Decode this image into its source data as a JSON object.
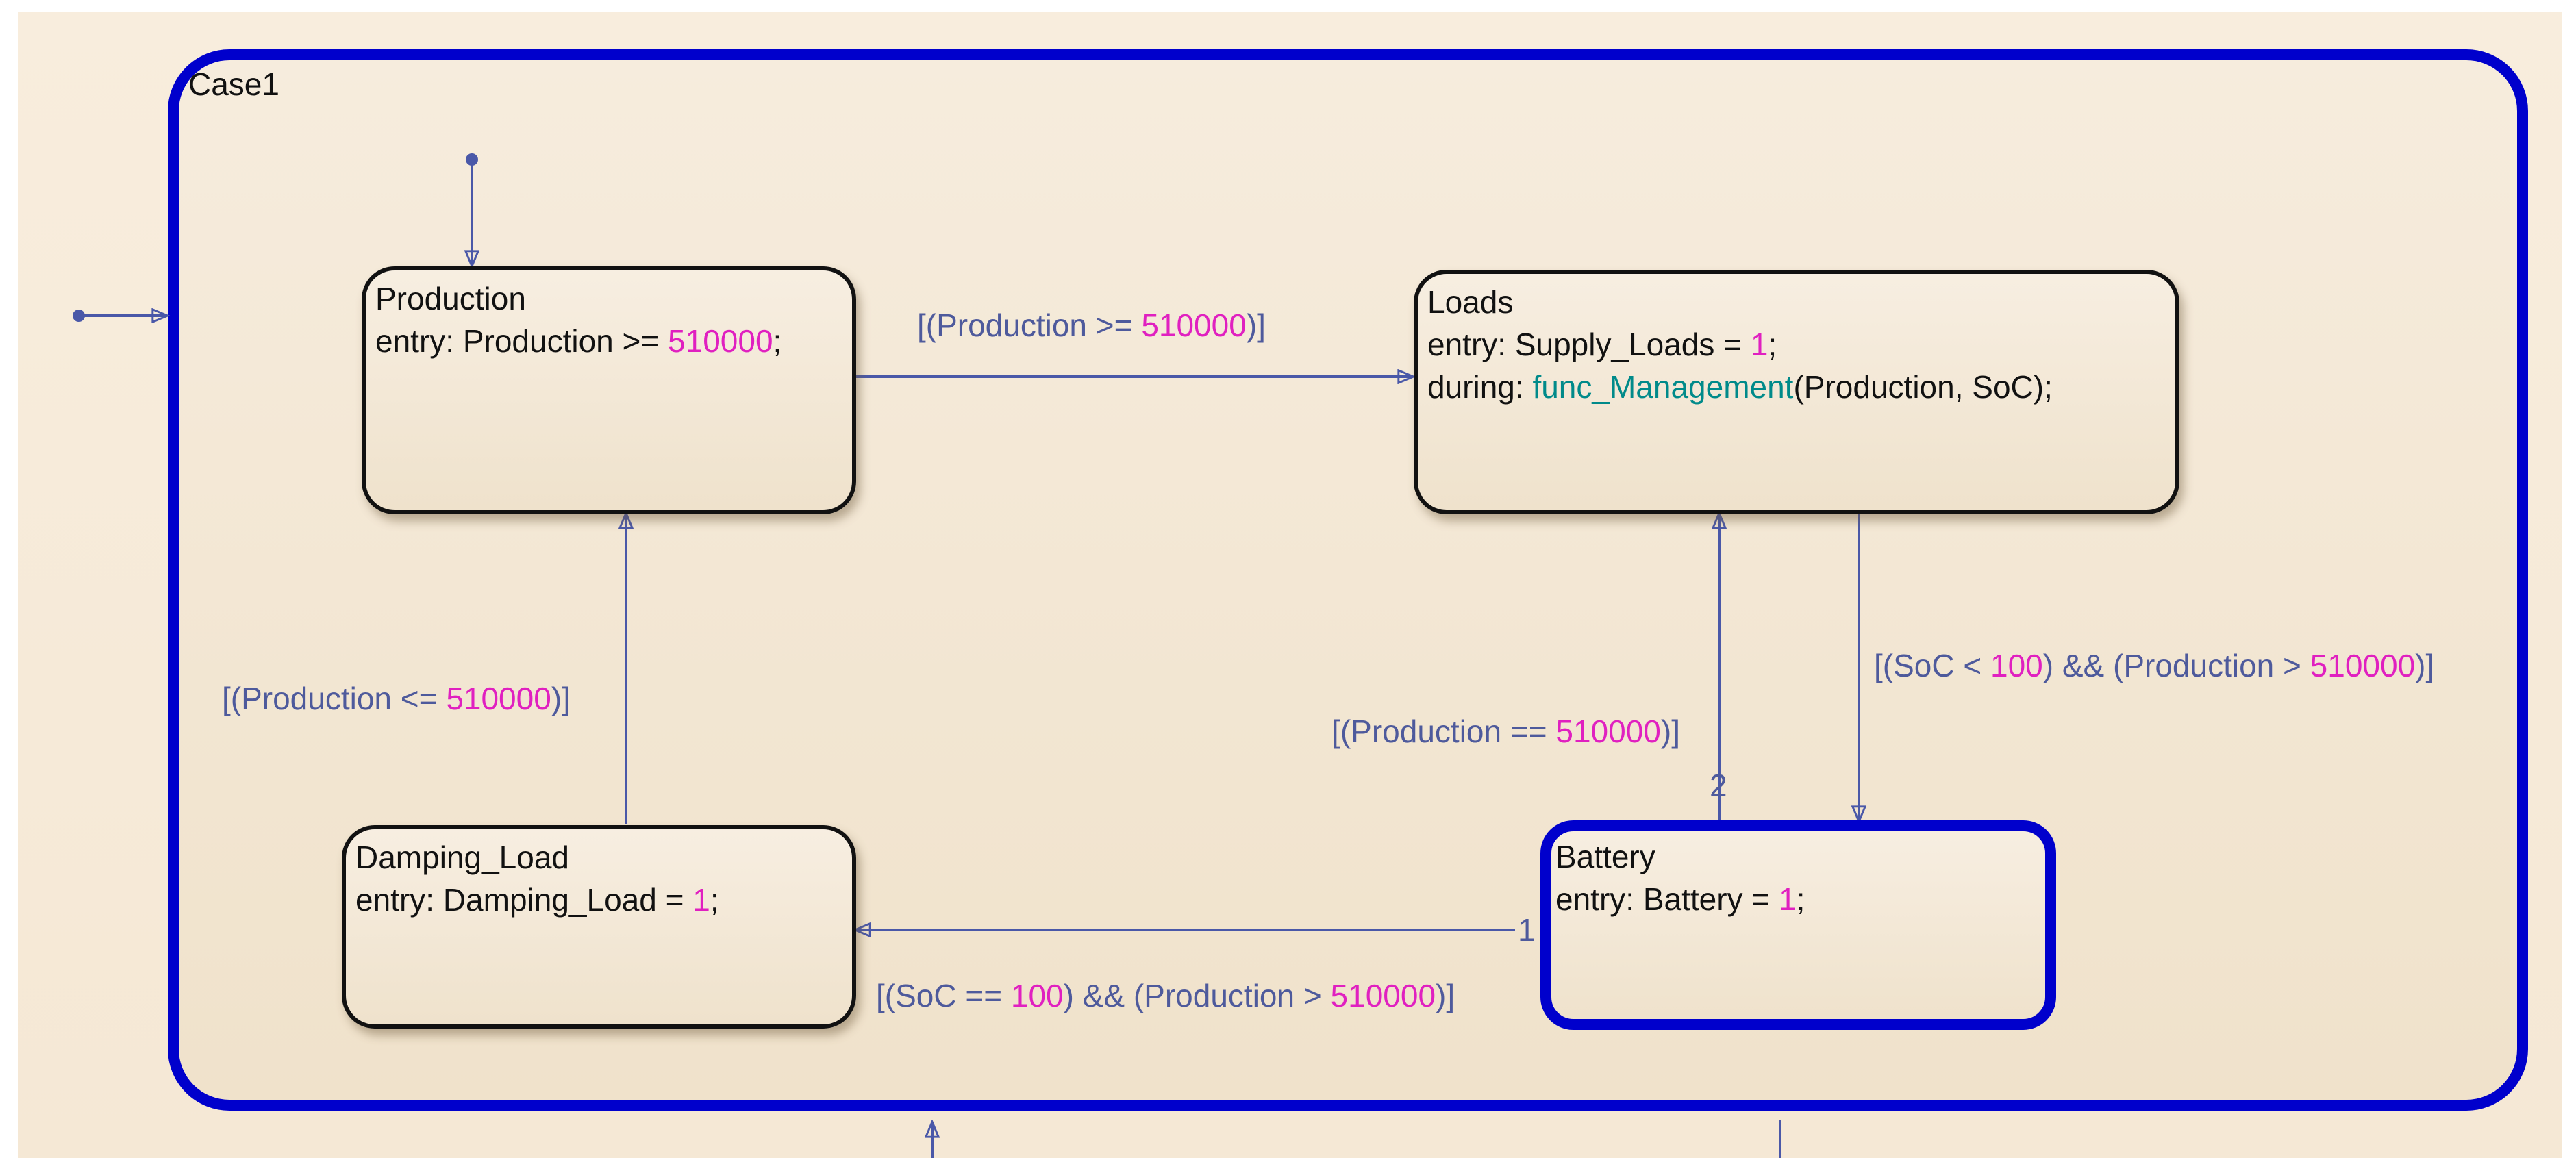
{
  "chart": {
    "name": "Case1",
    "states": {
      "production": {
        "name": "Production",
        "entry_kw": "entry:",
        "entry_expr": " Production >= ",
        "entry_num": "510000",
        "entry_end": ";"
      },
      "loads": {
        "name": "Loads",
        "entry_kw": "entry:",
        "entry_expr": " Supply_Loads = ",
        "entry_num": "1",
        "entry_end": ";",
        "during_kw": "during:",
        "during_fn": "func_Management",
        "during_args": "(Production, SoC);"
      },
      "damping": {
        "name": "Damping_Load",
        "entry_kw": "entry:",
        "entry_expr": " Damping_Load = ",
        "entry_num": "1",
        "entry_end": ";"
      },
      "battery": {
        "name": "Battery",
        "entry_kw": "entry:",
        "entry_expr": " Battery = ",
        "entry_num": "1",
        "entry_end": ";"
      }
    },
    "transitions": {
      "prod_to_loads": {
        "a": "[(Production >= ",
        "n": "510000",
        "b": ")]"
      },
      "damping_to_prod": {
        "a": "[(Production <= ",
        "n": "510000",
        "b": ")]"
      },
      "battery_to_loads": {
        "a": "[(Production == ",
        "n": "510000",
        "b": ")]",
        "order": "2"
      },
      "loads_to_battery": {
        "a": "[(SoC < ",
        "n1": "100",
        "b": ") && (Production > ",
        "n2": "510000",
        "c": ")]"
      },
      "battery_to_damping": {
        "a": "[(SoC == ",
        "n1": "100",
        "b": ") && (Production > ",
        "n2": "510000",
        "c": ")]",
        "order": "1"
      }
    },
    "colors": {
      "active_state": "#0000cc",
      "transition": "#4e5a9c",
      "number": "#e020c0",
      "function": "#008a8a"
    }
  }
}
